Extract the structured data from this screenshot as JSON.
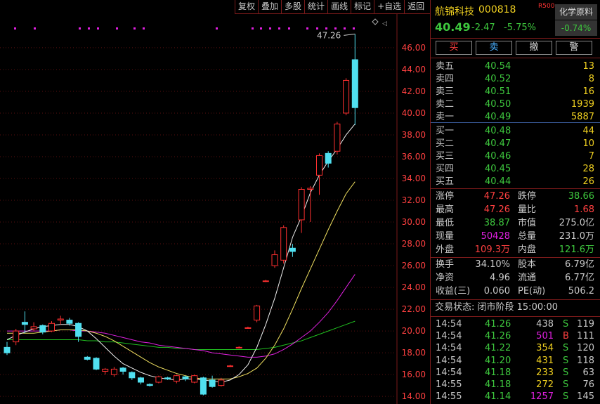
{
  "toolbar": {
    "buttons": [
      "复权",
      "叠加",
      "多股",
      "统计",
      "画线",
      "标记",
      "+自选",
      "返回"
    ]
  },
  "stock": {
    "name": "航锦科技",
    "code": "000818",
    "tag": "R500",
    "price": "40.49",
    "change": "-2.47",
    "change_pct": "-5.75%",
    "sector": "化学原料",
    "sector_change": "-0.74%"
  },
  "trade_buttons": [
    "买",
    "卖",
    "撤",
    "警"
  ],
  "asks": [
    {
      "label": "卖五",
      "price": "40.54",
      "vol": "13"
    },
    {
      "label": "卖四",
      "price": "40.52",
      "vol": "8"
    },
    {
      "label": "卖三",
      "price": "40.51",
      "vol": "16"
    },
    {
      "label": "卖二",
      "price": "40.50",
      "vol": "1939"
    },
    {
      "label": "卖一",
      "price": "40.49",
      "vol": "5887"
    }
  ],
  "bids": [
    {
      "label": "买一",
      "price": "40.48",
      "vol": "44"
    },
    {
      "label": "买二",
      "price": "40.47",
      "vol": "10"
    },
    {
      "label": "买三",
      "price": "40.46",
      "vol": "7"
    },
    {
      "label": "买四",
      "price": "40.45",
      "vol": "28"
    },
    {
      "label": "买五",
      "price": "40.44",
      "vol": "26"
    }
  ],
  "stats": [
    {
      "l1": "涨停",
      "v1": "47.26",
      "c1": "r",
      "l2": "跌停",
      "v2": "38.66",
      "c2": "g"
    },
    {
      "l1": "最高",
      "v1": "47.26",
      "c1": "r",
      "l2": "量比",
      "v2": "1.68",
      "c2": "r"
    },
    {
      "l1": "最低",
      "v1": "38.87",
      "c1": "g",
      "l2": "市值",
      "v2": "275.0亿",
      "c2": "w"
    },
    {
      "l1": "现量",
      "v1": "50428",
      "c1": "m",
      "l2": "总量",
      "v2": "231.0万",
      "c2": "w"
    },
    {
      "l1": "外盘",
      "v1": "109.3万",
      "c1": "r",
      "l2": "内盘",
      "v2": "121.6万",
      "c2": "g"
    }
  ],
  "stats2": [
    {
      "l1": "换手",
      "v1": "34.10%",
      "l2": "股本",
      "v2": "6.79亿"
    },
    {
      "l1": "净资",
      "v1": "4.96",
      "l2": "流通",
      "v2": "6.77亿"
    },
    {
      "l1": "收益(三)",
      "v1": "0.060",
      "l2": "PE(动)",
      "v2": "506.2"
    }
  ],
  "trade_status": "交易状态: 闭市阶段 15:00:00",
  "ticks": [
    {
      "t": "14:54",
      "p": "41.26",
      "v": "438",
      "s": "S",
      "n": "119",
      "c": "w",
      "sc": "g"
    },
    {
      "t": "14:54",
      "p": "41.26",
      "v": "501",
      "s": "B",
      "n": "111",
      "c": "m",
      "sc": "r"
    },
    {
      "t": "14:54",
      "p": "41.22",
      "v": "354",
      "s": "S",
      "n": "120",
      "c": "y",
      "sc": "g"
    },
    {
      "t": "14:54",
      "p": "41.20",
      "v": "431",
      "s": "S",
      "n": "118",
      "c": "y",
      "sc": "g"
    },
    {
      "t": "14:54",
      "p": "41.18",
      "v": "233",
      "s": "S",
      "n": "63",
      "c": "y",
      "sc": "g"
    },
    {
      "t": "14:55",
      "p": "41.18",
      "v": "272",
      "s": "S",
      "n": "76",
      "c": "y",
      "sc": "g"
    },
    {
      "t": "14:55",
      "p": "41.14",
      "v": "1257",
      "s": "S",
      "n": "145",
      "c": "m",
      "sc": "g"
    }
  ],
  "chart_data": {
    "type": "candlestick",
    "ylim": [
      13.3,
      47.8
    ],
    "yticks": [
      14,
      16,
      18,
      20,
      22,
      24,
      26,
      28,
      30,
      32,
      34,
      36,
      38,
      40,
      42,
      44,
      46
    ],
    "annotation": "47.26",
    "candles": [
      [
        18.5,
        18.0,
        19.0,
        17.8
      ],
      [
        19.0,
        20.0,
        20.2,
        18.7
      ],
      [
        20.8,
        20.6,
        21.8,
        19.8
      ],
      [
        20.2,
        20.4,
        20.8,
        20.0
      ],
      [
        20.5,
        19.9,
        20.6,
        19.7
      ],
      [
        20.0,
        20.7,
        20.9,
        19.9
      ],
      [
        21.0,
        21.1,
        21.4,
        20.6
      ],
      [
        21.0,
        20.7,
        21.2,
        20.5
      ],
      [
        20.7,
        19.5,
        20.8,
        19.0
      ],
      [
        17.6,
        17.4,
        17.7,
        17.3
      ],
      [
        17.5,
        16.5,
        17.6,
        16.4
      ],
      [
        16.3,
        16.5,
        16.6,
        16.0
      ],
      [
        16.0,
        16.5,
        16.7,
        15.8
      ],
      [
        16.6,
        16.3,
        16.7,
        16.0
      ],
      [
        16.2,
        15.7,
        16.3,
        15.5
      ],
      [
        15.7,
        15.3,
        15.8,
        15.1
      ],
      [
        15.1,
        15.0,
        15.2,
        14.9
      ],
      [
        15.3,
        15.8,
        15.9,
        15.2
      ],
      [
        15.7,
        15.6,
        15.8,
        15.5
      ],
      [
        15.4,
        15.9,
        16.0,
        15.2
      ],
      [
        15.8,
        15.6,
        15.9,
        15.4
      ],
      [
        15.3,
        15.9,
        16.0,
        15.2
      ],
      [
        15.7,
        14.2,
        15.8,
        14.1
      ],
      [
        15.5,
        14.9,
        15.9,
        14.8
      ],
      [
        15.0,
        15.5,
        15.7,
        14.9
      ],
      [
        16.8,
        16.8,
        16.9,
        16.7
      ],
      [
        18.5,
        18.5,
        18.6,
        18.4
      ],
      [
        20.3,
        20.3,
        20.4,
        20.2
      ],
      [
        21.0,
        22.3,
        22.4,
        20.8
      ],
      [
        24.6,
        24.6,
        24.7,
        24.5
      ],
      [
        26.0,
        27.0,
        27.4,
        25.8
      ],
      [
        26.5,
        29.5,
        29.7,
        26.2
      ],
      [
        27.6,
        27.3,
        28.0,
        26.8
      ],
      [
        30.2,
        33.0,
        33.2,
        29.0
      ],
      [
        33.0,
        33.1,
        33.3,
        30.0
      ],
      [
        34.3,
        36.1,
        36.3,
        32.5
      ],
      [
        36.3,
        35.4,
        36.5,
        35.0
      ],
      [
        36.5,
        39.0,
        39.2,
        36.2
      ],
      [
        40.0,
        43.0,
        43.2,
        39.8
      ],
      [
        44.9,
        40.5,
        47.26,
        38.9
      ]
    ],
    "ma5": [
      19.2,
      19.6,
      19.9,
      20.2,
      20.4,
      20.5,
      20.6,
      20.6,
      20.4,
      20.0,
      19.3,
      18.5,
      17.7,
      17.0,
      16.6,
      16.2,
      15.9,
      15.7,
      15.6,
      15.5,
      15.6,
      15.6,
      15.5,
      15.4,
      15.3,
      15.5,
      16.0,
      16.9,
      18.5,
      20.6,
      23.0,
      25.8,
      28.6,
      30.5,
      32.7,
      34.3,
      35.6,
      36.7,
      38.0,
      39.0
    ],
    "ma10": [
      19.8,
      19.8,
      19.8,
      19.8,
      19.9,
      20.0,
      20.1,
      20.1,
      20.1,
      20.0,
      19.8,
      19.5,
      19.1,
      18.6,
      18.1,
      17.6,
      17.1,
      16.7,
      16.4,
      16.1,
      15.9,
      15.7,
      15.6,
      15.6,
      15.6,
      15.6,
      15.8,
      16.1,
      16.6,
      17.5,
      18.7,
      20.2,
      22.0,
      23.9,
      25.7,
      27.5,
      29.3,
      31.0,
      32.6,
      33.7
    ],
    "ma20": [
      20.0,
      20.0,
      20.0,
      20.0,
      20.0,
      20.0,
      20.1,
      20.1,
      20.0,
      20.0,
      19.9,
      19.8,
      19.6,
      19.4,
      19.2,
      19.0,
      18.9,
      18.7,
      18.6,
      18.5,
      18.4,
      18.3,
      18.2,
      18.0,
      17.9,
      17.8,
      17.7,
      17.6,
      17.6,
      17.7,
      17.9,
      18.3,
      18.8,
      19.4,
      20.0,
      20.8,
      21.7,
      22.8,
      24.0,
      25.2
    ],
    "ma60": [
      19.2,
      19.2,
      19.2,
      19.2,
      19.2,
      19.2,
      19.2,
      19.2,
      19.2,
      19.1,
      19.1,
      19.0,
      19.0,
      18.9,
      18.8,
      18.7,
      18.6,
      18.5,
      18.5,
      18.4,
      18.4,
      18.3,
      18.3,
      18.3,
      18.3,
      18.3,
      18.3,
      18.3,
      18.3,
      18.4,
      18.5,
      18.7,
      18.9,
      19.1,
      19.4,
      19.7,
      20.0,
      20.3,
      20.6,
      20.9
    ]
  }
}
